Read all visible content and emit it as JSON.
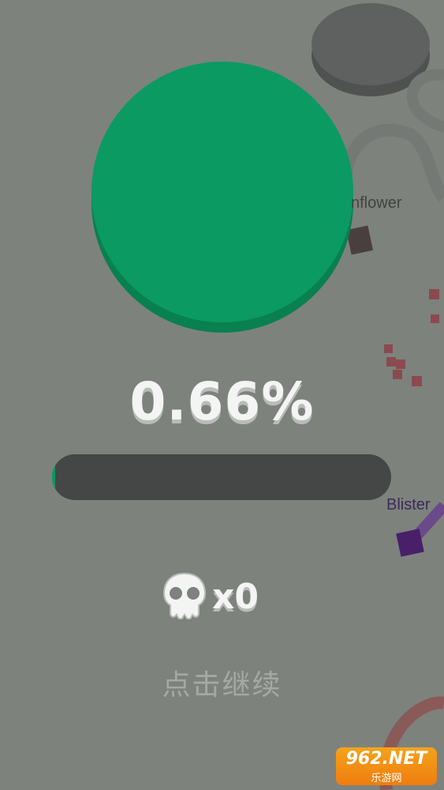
{
  "game": {
    "territory_percent": "0.66%",
    "territory_progress": 0.0066,
    "kill_count_text": "x0",
    "kills": 0,
    "continue_prompt": "点击继续",
    "player_color": "#0b9a62"
  },
  "opponents": [
    {
      "name": "nflower",
      "color": "#4a3f3f"
    },
    {
      "name": "Blister",
      "color": "#5a2a7a"
    }
  ],
  "watermark": {
    "main": "962.NET",
    "sub": "乐游网"
  },
  "icons": {
    "skull": "skull-icon"
  }
}
